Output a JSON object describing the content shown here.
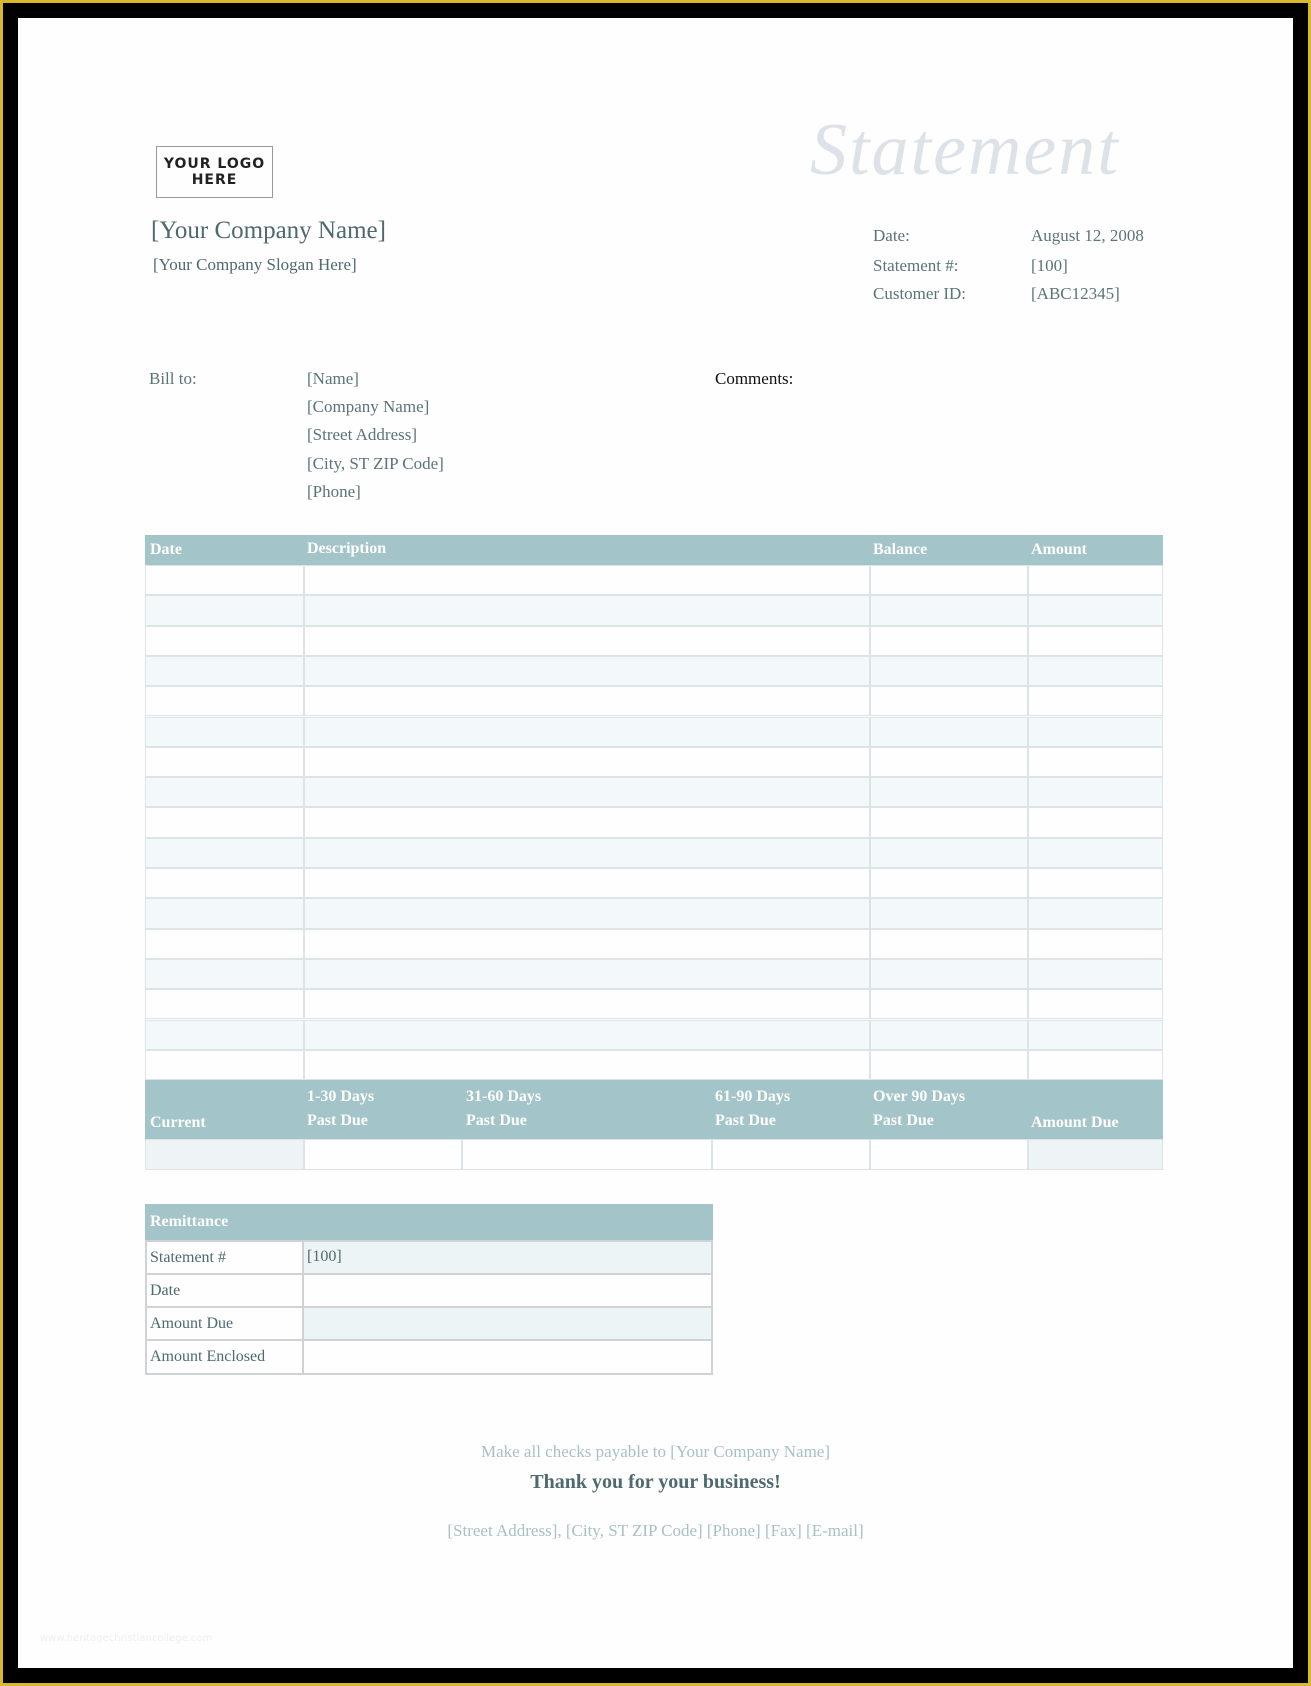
{
  "logo": {
    "line1": "YOUR LOGO",
    "line2": "HERE"
  },
  "document_title": "Statement",
  "company": {
    "name": "[Your Company Name]",
    "slogan": "[Your Company Slogan Here]"
  },
  "meta": [
    {
      "label": "Date:",
      "value": "August 12, 2008"
    },
    {
      "label": "Statement #:",
      "value": "[100]"
    },
    {
      "label": "Customer ID:",
      "value": "[ABC12345]"
    }
  ],
  "bill_to": {
    "label": "Bill to:",
    "lines": [
      "[Name]",
      "[Company Name]",
      "[Street Address]",
      "[City, ST  ZIP Code]",
      "[Phone]"
    ]
  },
  "comments": {
    "label": "Comments:"
  },
  "statement_table": {
    "columns": [
      "Date",
      "Description",
      "Balance",
      "Amount"
    ],
    "row_count": 17
  },
  "aging_table": {
    "columns": [
      {
        "line1": "",
        "line2": "Current"
      },
      {
        "line1": "1-30 Days",
        "line2": "Past Due"
      },
      {
        "line1": "31-60 Days",
        "line2": "Past Due"
      },
      {
        "line1": "61-90 Days",
        "line2": "Past Due"
      },
      {
        "line1": "Over 90 Days",
        "line2": "Past Due"
      },
      {
        "line1": "",
        "line2": "Amount Due"
      }
    ]
  },
  "remittance": {
    "title": "Remittance",
    "rows": [
      {
        "label": "Statement #",
        "value": "[100]"
      },
      {
        "label": "Date",
        "value": ""
      },
      {
        "label": "Amount Due",
        "value": ""
      },
      {
        "label": "Amount Enclosed",
        "value": ""
      }
    ]
  },
  "footer": {
    "payable": "Make all checks payable to [Your Company Name]",
    "thanks": "Thank you for your business!",
    "contact": "[Street Address], [City, ST  ZIP Code]  [Phone]  [Fax]  [E-mail]"
  },
  "watermark": "www.heritagechristiancollege.com",
  "colors": {
    "header_fill": "#a3c4c9",
    "row_tint": "#f3f8fa",
    "text_slate": "#4e6970",
    "title_faint": "#dde2e8",
    "frame_black": "#000000",
    "frame_gold": "#d8b92e"
  }
}
